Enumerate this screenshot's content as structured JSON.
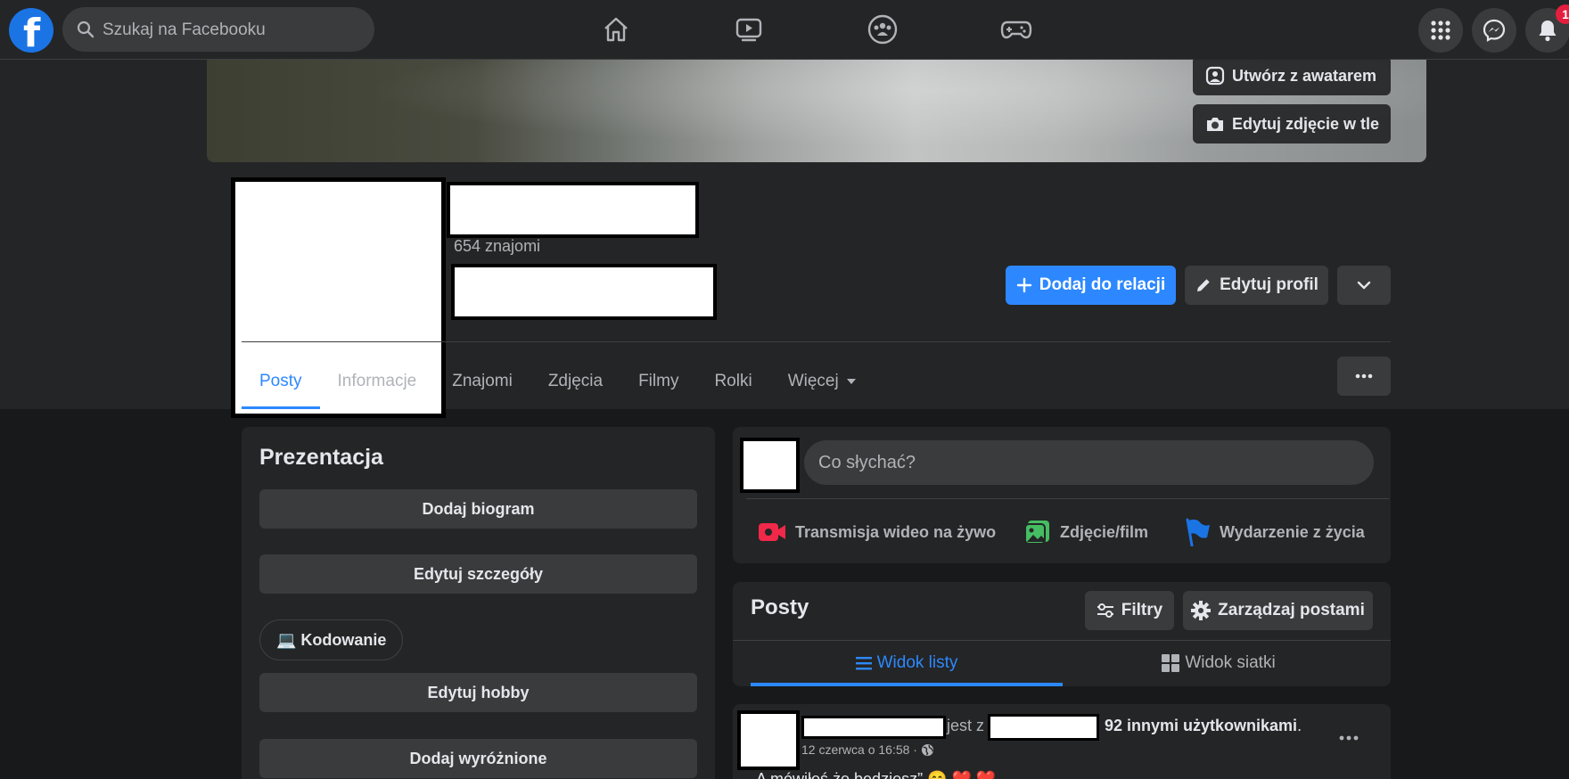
{
  "topbar": {
    "logo_letter": "f",
    "search_placeholder": "Szukaj na Facebooku",
    "nav_icons": [
      "home-icon",
      "watch-icon",
      "groups-icon",
      "gaming-icon"
    ],
    "right_icons": [
      "menu-grid-icon",
      "messenger-icon",
      "bell-icon"
    ],
    "notification_count": "1"
  },
  "cover": {
    "avatar_button_label": "Utwórz z awatarem",
    "edit_cover_label": "Edytuj zdjęcie w tle"
  },
  "profile": {
    "friends_count": "654 znajomi",
    "add_story_label": "Dodaj do relacji",
    "edit_profile_label": "Edytuj profil"
  },
  "tabs": {
    "items": [
      "Posty",
      "Informacje",
      "Znajomi",
      "Zdjęcia",
      "Filmy",
      "Rolki",
      "Więcej"
    ]
  },
  "intro": {
    "title": "Prezentacja",
    "add_bio_label": "Dodaj biogram",
    "edit_details_label": "Edytuj szczegóły",
    "hobby_chip": "💻 Kodowanie",
    "edit_hobbies_label": "Edytuj hobby",
    "add_featured_label": "Dodaj wyróżnione"
  },
  "composer": {
    "placeholder": "Co słychać?",
    "live_label": "Transmisja wideo na żywo",
    "photo_label": "Zdjęcie/film",
    "life_event_label": "Wydarzenie z życia"
  },
  "posts": {
    "title": "Posty",
    "filters_label": "Filtry",
    "manage_label": "Zarządzaj postami",
    "list_view_label": "Widok listy",
    "grid_view_label": "Widok siatki"
  },
  "post": {
    "with_text": "jest z",
    "others_text": "92 innymi użytkownikami",
    "others_dot": ".",
    "timestamp": "12 czerwca o 16:58 ·",
    "body_text": "„A mówiłeś że będziesz” 😊 ❤️ ❤️"
  },
  "colors": {
    "accent": "#2d88ff",
    "background": "#18191a",
    "surface": "#242526",
    "button": "#3a3b3c",
    "notification": "#e41e3f"
  }
}
